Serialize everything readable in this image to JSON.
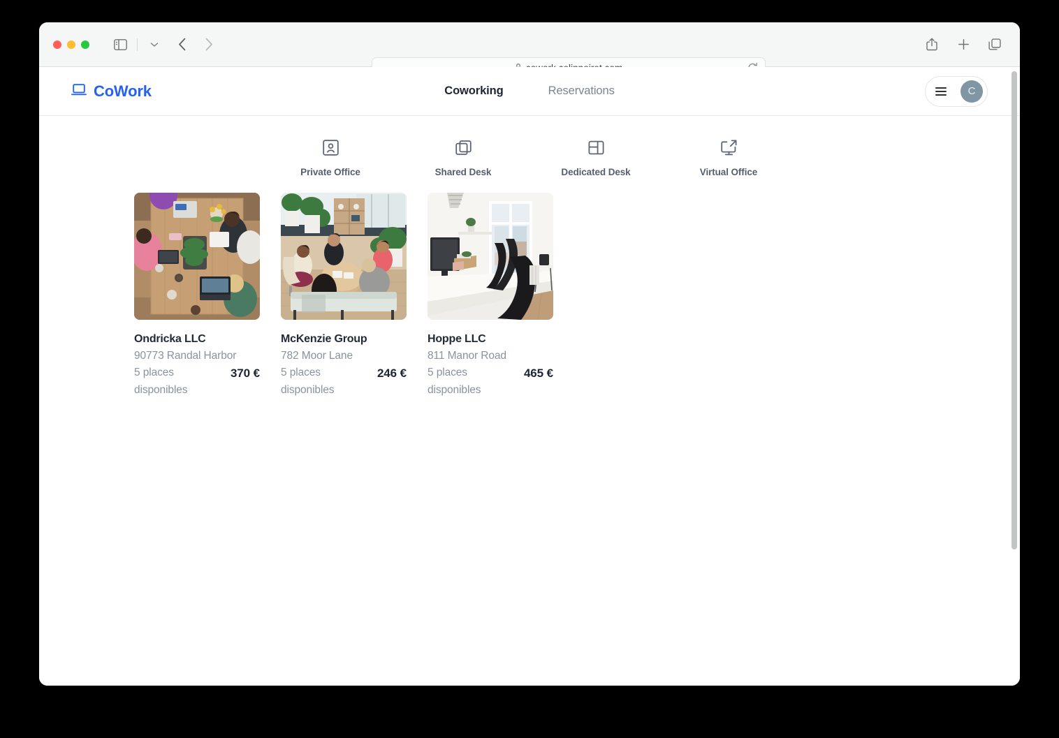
{
  "browser": {
    "url": "cowork.colinnoiret.com",
    "lock_icon": "lock-icon",
    "reload_icon": "reload-icon",
    "sidebar_icon": "sidebar-toggle-icon",
    "dropdown_icon": "chevron-down-icon",
    "back_icon": "chevron-left-icon",
    "forward_icon": "chevron-right-icon",
    "share_icon": "share-icon",
    "newtab_icon": "plus-icon",
    "tabs_icon": "tab-overview-icon"
  },
  "header": {
    "brand": "CoWork",
    "brand_icon": "laptop-icon",
    "brand_color": "#2563eb",
    "nav": [
      {
        "label": "Coworking",
        "active": true
      },
      {
        "label": "Reservations",
        "active": false
      }
    ],
    "account": {
      "menu_icon": "hamburger-icon",
      "avatar_initial": "C",
      "avatar_color": "#8096a4"
    }
  },
  "categories": [
    {
      "label": "Private Office",
      "icon": "contact-card-icon"
    },
    {
      "label": "Shared Desk",
      "icon": "overlapping-squares-icon"
    },
    {
      "label": "Dedicated Desk",
      "icon": "layout-panels-icon"
    },
    {
      "label": "Virtual Office",
      "icon": "monitor-external-icon"
    }
  ],
  "listings": [
    {
      "name": "Ondricka LLC",
      "address": "90773 Randal Harbor",
      "availability": "5 places disponibles",
      "price": "370 €",
      "image": "coworking-table-overhead"
    },
    {
      "name": "McKenzie Group",
      "address": "782 Moor Lane",
      "availability": "5 places disponibles",
      "price": "246 €",
      "image": "lounge-group-meeting"
    },
    {
      "name": "Hoppe LLC",
      "address": "811 Manor Road",
      "availability": "5 places disponibles",
      "price": "465 €",
      "image": "white-office-desks"
    }
  ]
}
